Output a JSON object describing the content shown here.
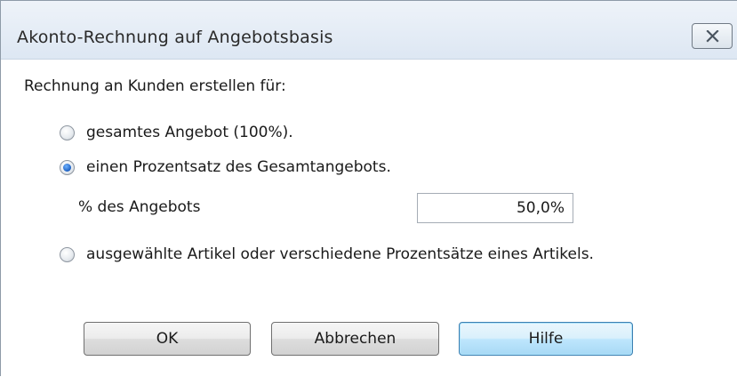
{
  "window": {
    "title": "Akonto-Rechnung auf Angebotsbasis",
    "close_icon": "close-icon"
  },
  "form": {
    "heading": "Rechnung an Kunden erstellen für:",
    "options": [
      {
        "label": "gesamtes Angebot (100%).",
        "checked": false
      },
      {
        "label": "einen Prozentsatz des Gesamtangebots.",
        "checked": true
      },
      {
        "label": "ausgewählte Artikel oder verschiedene Prozentsätze eines Artikels.",
        "checked": false
      }
    ],
    "percent_label": "% des Angebots",
    "percent_value": "50,0%"
  },
  "buttons": {
    "ok": "OK",
    "cancel": "Abbrechen",
    "help": "Hilfe"
  }
}
